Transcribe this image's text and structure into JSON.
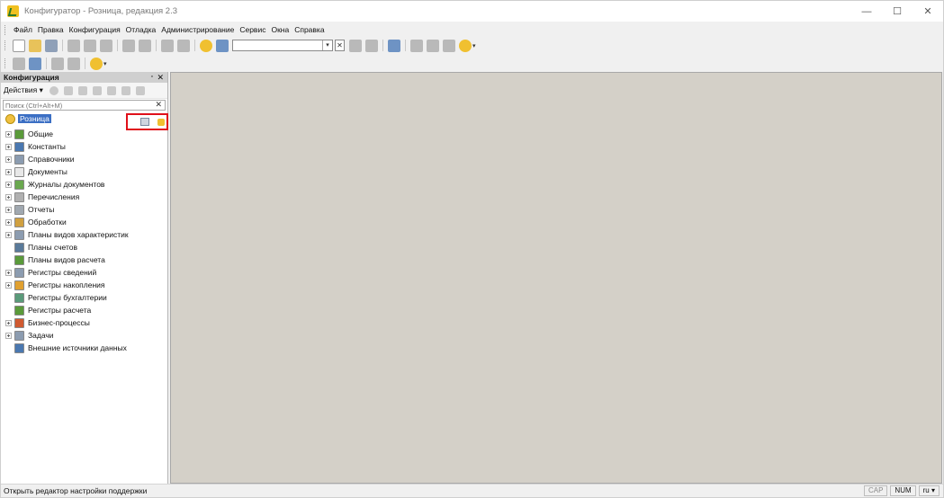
{
  "window": {
    "title": "Конфигуратор - Розница, редакция 2.3",
    "controls": {
      "minimize": "—",
      "maximize": "☐",
      "close": "✕"
    }
  },
  "menu": [
    "Файл",
    "Правка",
    "Конфигурация",
    "Отладка",
    "Администрирование",
    "Сервис",
    "Окна",
    "Справка"
  ],
  "toolbar": {
    "search_value": "",
    "combo_arrow": "▾",
    "combo_clear": "✕",
    "more_chevron": "▾"
  },
  "panel": {
    "title": "Конфигурация",
    "pin": "▫",
    "close": "✕",
    "actions_label": "Действия ▾",
    "search_placeholder": "Поиск (Ctrl+Alt+M)",
    "search_clear": "✕",
    "root_label": "Розница",
    "tree": [
      {
        "label": "Общие",
        "icon_color": "#5a9a3a",
        "expandable": true
      },
      {
        "label": "Константы",
        "icon_color": "#4a78b0",
        "expandable": true
      },
      {
        "label": "Справочники",
        "icon_color": "#8c9cb0",
        "expandable": true
      },
      {
        "label": "Документы",
        "icon_color": "#e8e8e8",
        "expandable": true
      },
      {
        "label": "Журналы документов",
        "icon_color": "#6aa84f",
        "expandable": true
      },
      {
        "label": "Перечисления",
        "icon_color": "#b0b0b0",
        "expandable": true
      },
      {
        "label": "Отчеты",
        "icon_color": "#a0a8b0",
        "expandable": true
      },
      {
        "label": "Обработки",
        "icon_color": "#d0a040",
        "expandable": true
      },
      {
        "label": "Планы видов характеристик",
        "icon_color": "#8c9cb0",
        "expandable": true
      },
      {
        "label": "Планы счетов",
        "icon_color": "#5a7a9a",
        "expandable": false
      },
      {
        "label": "Планы видов расчета",
        "icon_color": "#5a9a3a",
        "expandable": false
      },
      {
        "label": "Регистры сведений",
        "icon_color": "#8c9cb0",
        "expandable": true
      },
      {
        "label": "Регистры накопления",
        "icon_color": "#e0a030",
        "expandable": true
      },
      {
        "label": "Регистры бухгалтерии",
        "icon_color": "#5a9a7a",
        "expandable": false
      },
      {
        "label": "Регистры расчета",
        "icon_color": "#5a9a3a",
        "expandable": false
      },
      {
        "label": "Бизнес-процессы",
        "icon_color": "#d05a30",
        "expandable": true
      },
      {
        "label": "Задачи",
        "icon_color": "#8c9cb0",
        "expandable": true
      },
      {
        "label": "Внешние источники данных",
        "icon_color": "#4a78b0",
        "expandable": false
      }
    ]
  },
  "status": {
    "message": "Открыть редактор настройки поддержки",
    "cap": "CAP",
    "num": "NUM",
    "lang": "ru ▾"
  },
  "colors": {
    "selection": "#3b6fc4",
    "highlight": "#e0101a",
    "mdi_background": "#d4d0c8"
  }
}
